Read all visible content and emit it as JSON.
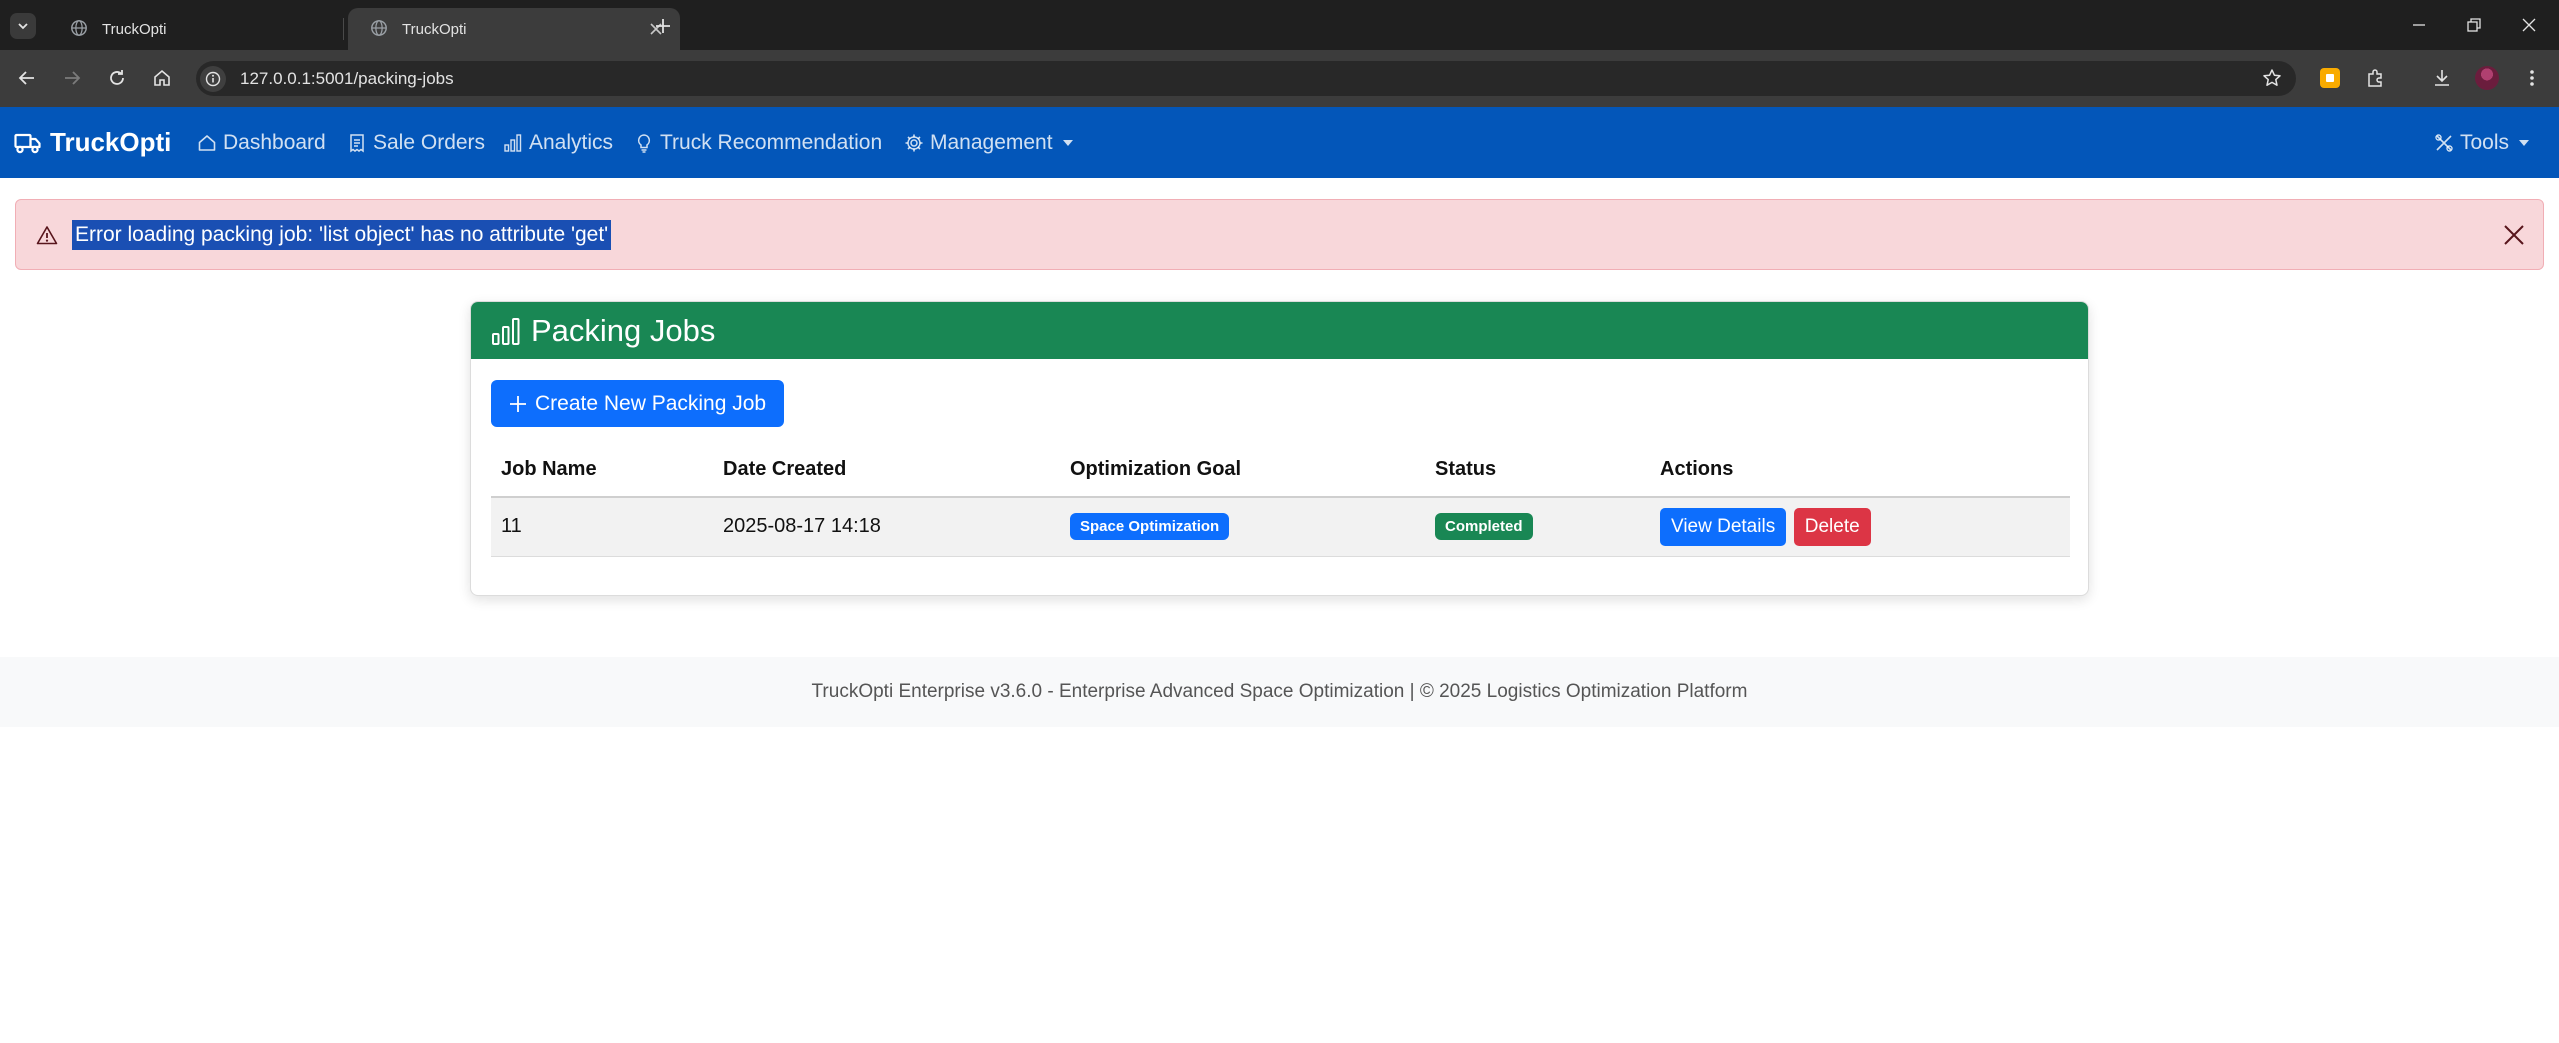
{
  "browser": {
    "tabs": [
      {
        "title": "TruckOpti",
        "active": false
      },
      {
        "title": "TruckOpti",
        "active": true
      }
    ],
    "url": "127.0.0.1:5001/packing-jobs"
  },
  "navbar": {
    "brand": "TruckOpti",
    "links": [
      {
        "label": "Dashboard",
        "icon": "house-icon"
      },
      {
        "label": "Sale Orders",
        "icon": "receipt-icon"
      },
      {
        "label": "Analytics",
        "icon": "bar-chart-icon"
      },
      {
        "label": "Truck Recommendation",
        "icon": "lightbulb-icon"
      },
      {
        "label": "Management",
        "icon": "gear-icon"
      }
    ],
    "tools": "Tools"
  },
  "alert": {
    "message": "Error loading packing job: 'list object' has no attribute 'get'"
  },
  "card": {
    "title": "Packing Jobs",
    "create_button": "Create New Packing Job",
    "table": {
      "headers": [
        "Job Name",
        "Date Created",
        "Optimization Goal",
        "Status",
        "Actions"
      ],
      "rows": [
        {
          "job_name": "11",
          "date_created": "2025-08-17 14:18",
          "goal": "Space Optimization",
          "status": "Completed",
          "view_label": "View Details",
          "delete_label": "Delete"
        }
      ]
    }
  },
  "footer": {
    "text": "TruckOpti Enterprise v3.6.0 - Enterprise Advanced Space Optimization | © 2025 Logistics Optimization Platform"
  },
  "colors": {
    "navbar": "#0356b9",
    "card_header": "#198754",
    "primary": "#0d6efd",
    "danger": "#dc3545",
    "alert_bg": "#f8d7da"
  }
}
